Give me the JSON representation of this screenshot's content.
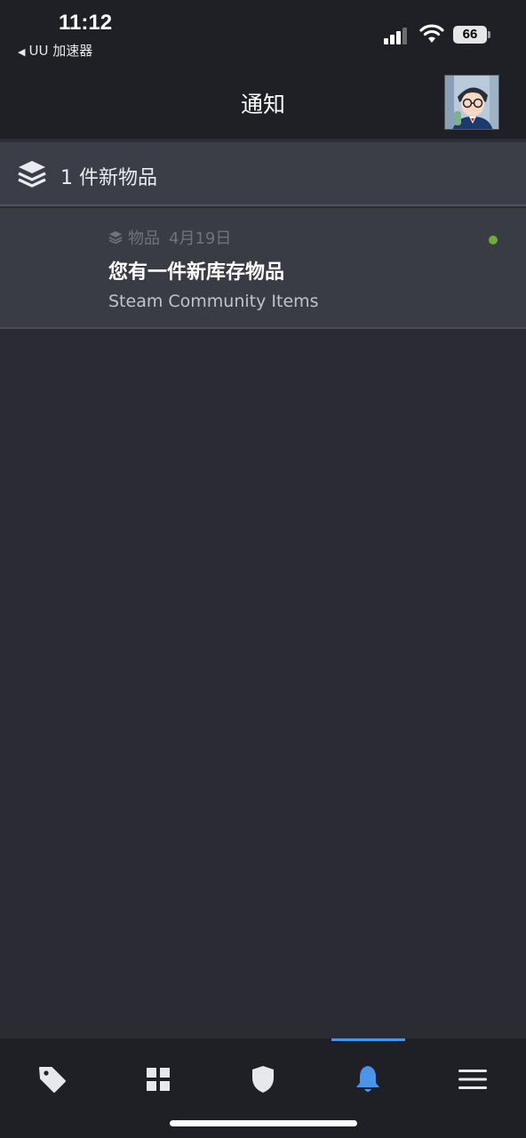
{
  "status_bar": {
    "time": "11:12",
    "back_app": "UU 加速器",
    "battery": "66"
  },
  "header": {
    "title": "通知"
  },
  "group": {
    "label": "1 件新物品",
    "icon": "stack-icon"
  },
  "notification": {
    "category": "物品",
    "date": "4月19日",
    "title": "您有一件新库存物品",
    "subtitle": "Steam Community Items",
    "unread": true
  },
  "tabbar": {
    "tabs": [
      {
        "icon": "tag-icon",
        "active": false
      },
      {
        "icon": "grid-icon",
        "active": false
      },
      {
        "icon": "shield-icon",
        "active": false
      },
      {
        "icon": "bell-icon",
        "active": true
      },
      {
        "icon": "menu-icon",
        "active": false
      }
    ]
  },
  "colors": {
    "background": "#2a2b33",
    "bar": "#1f2026",
    "accent": "#4a94e9",
    "unread_dot": "#6cae3a"
  }
}
